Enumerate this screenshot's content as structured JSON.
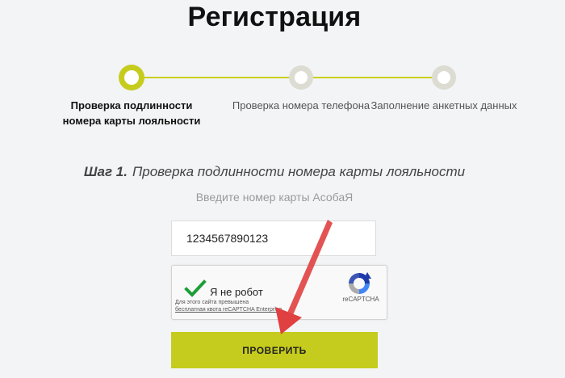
{
  "page": {
    "title": "Регистрация"
  },
  "stepper": {
    "steps": [
      {
        "label": "Проверка подлинности номера карты лояльности",
        "state": "active"
      },
      {
        "label": "Проверка номера телефона",
        "state": "inactive"
      },
      {
        "label": "Заполнение анкетных данных",
        "state": "inactive"
      }
    ]
  },
  "step_heading": {
    "number": "Шаг 1.",
    "text": "Проверка подлинности номера карты лояльности"
  },
  "card_field": {
    "hint": "Введите номер карты АсобаЯ",
    "value": "1234567890123"
  },
  "recaptcha": {
    "label": "Я не робот",
    "quota_prefix": "Для этого сайта превышена",
    "quota_link": "бесплатная квота reCAPTCHA Enterprise",
    "quota_suffix": ".",
    "brand": "reCAPTCHA",
    "checked": true
  },
  "verify_button": {
    "label": "ПРОВЕРИТЬ"
  },
  "colors": {
    "accent": "#c5cc1d",
    "background": "#f3f4f6",
    "annotation_arrow": "#e04040",
    "check": "#1e9e3a"
  }
}
